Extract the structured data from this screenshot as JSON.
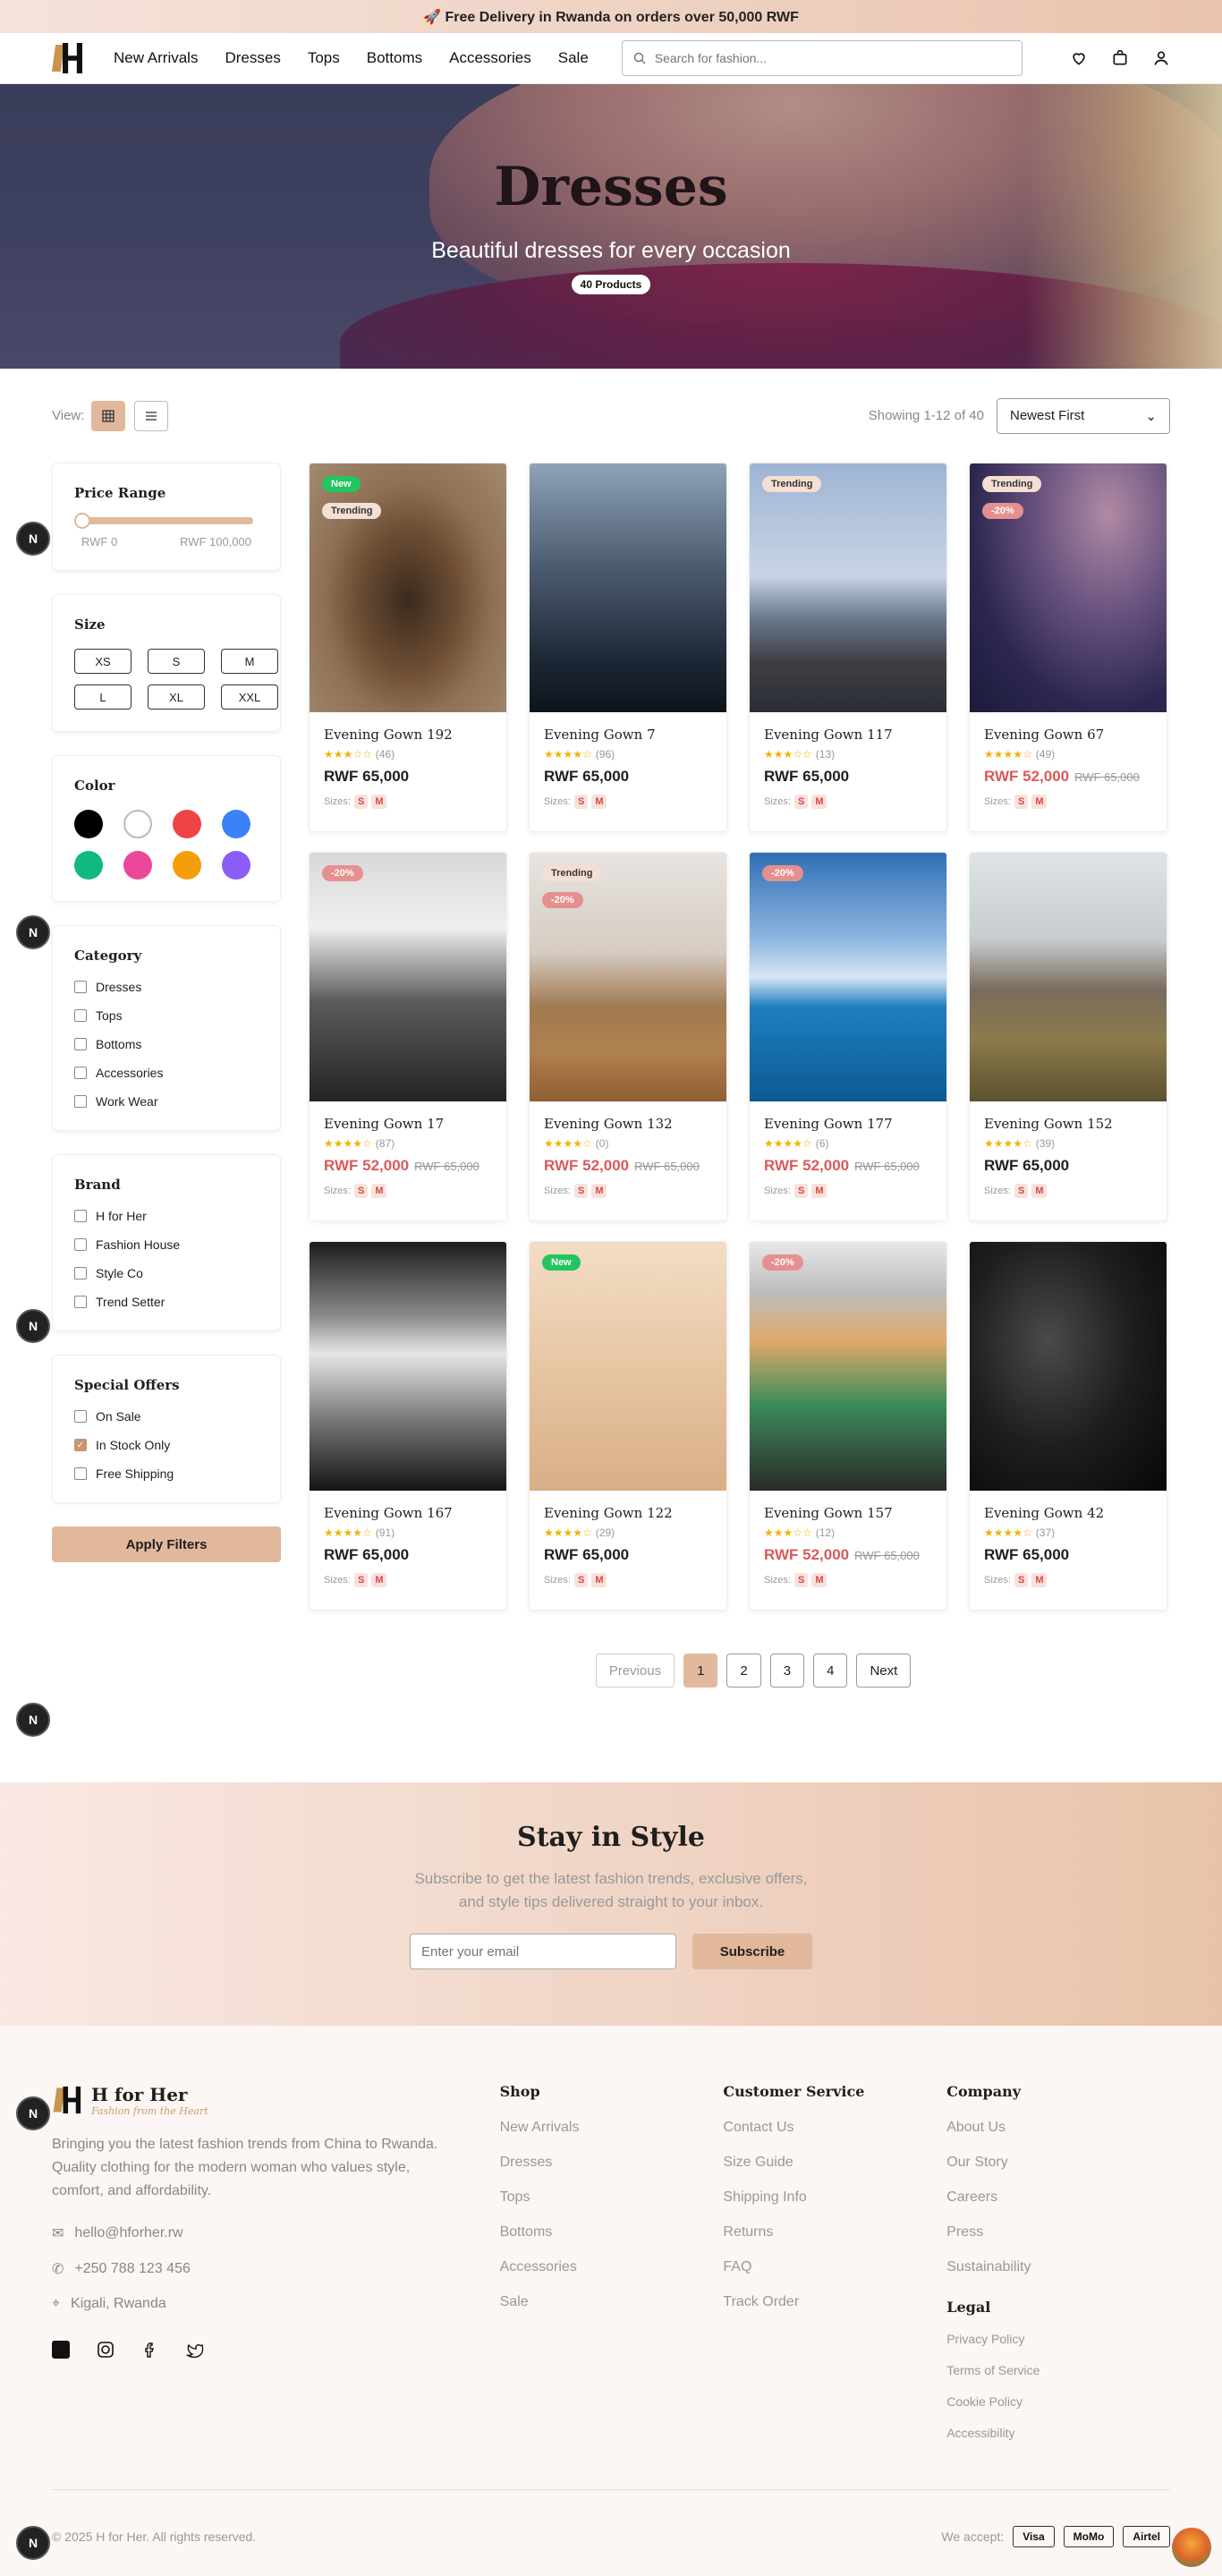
{
  "topbar": {
    "text": "🚀 Free Delivery in Rwanda on orders over 50,000 RWF"
  },
  "nav": {
    "links": [
      "New Arrivals",
      "Dresses",
      "Tops",
      "Bottoms",
      "Accessories",
      "Sale"
    ],
    "search_placeholder": "Search for fashion...",
    "icons": [
      "heart-icon",
      "cart-icon",
      "user-icon"
    ]
  },
  "hero": {
    "title": "Dresses",
    "subtitle": "Beautiful dresses for every occasion",
    "badge": "40 Products"
  },
  "toolbar": {
    "view_label": "View:",
    "showing": "Showing 1-12 of 40",
    "sort": "Newest First"
  },
  "filters": {
    "price": {
      "title": "Price Range",
      "min": "RWF 0",
      "max": "RWF 100,000"
    },
    "size": {
      "title": "Size",
      "options": [
        "XS",
        "S",
        "M",
        "L",
        "XL",
        "XXL"
      ]
    },
    "color": {
      "title": "Color",
      "swatches": [
        "#000000",
        "#ffffff",
        "#ef4444",
        "#3b82f6",
        "#10b981",
        "#ec4899",
        "#f59e0b",
        "#8b5cf6"
      ]
    },
    "category": {
      "title": "Category",
      "options": [
        "Dresses",
        "Tops",
        "Bottoms",
        "Accessories",
        "Work Wear"
      ]
    },
    "brand": {
      "title": "Brand",
      "options": [
        "H for Her",
        "Fashion House",
        "Style Co",
        "Trend Setter"
      ]
    },
    "offers": {
      "title": "Special Offers",
      "options": [
        "On Sale",
        "In Stock Only",
        "Free Shipping"
      ],
      "checked": [
        false,
        true,
        false
      ]
    },
    "apply": "Apply Filters"
  },
  "products": [
    {
      "name": "Evening Gown 192",
      "stars": "★★★☆☆",
      "reviews": "(46)",
      "price": "RWF 65,000",
      "old": "",
      "tags": [
        "New",
        "Trending"
      ],
      "sizes_label": "Sizes:",
      "sizes": [
        "S",
        "M"
      ]
    },
    {
      "name": "Evening Gown 7",
      "stars": "★★★★☆",
      "reviews": "(96)",
      "price": "RWF 65,000",
      "old": "",
      "tags": [],
      "sizes_label": "Sizes:",
      "sizes": [
        "S",
        "M"
      ]
    },
    {
      "name": "Evening Gown 117",
      "stars": "★★★☆☆",
      "reviews": "(13)",
      "price": "RWF 65,000",
      "old": "",
      "tags": [
        "Trending"
      ],
      "sizes_label": "Sizes:",
      "sizes": [
        "S",
        "M"
      ]
    },
    {
      "name": "Evening Gown 67",
      "stars": "★★★★☆",
      "reviews": "(49)",
      "price": "RWF 52,000",
      "old": "RWF 65,000",
      "tags": [
        "Trending",
        "-20%"
      ],
      "sizes_label": "Sizes:",
      "sizes": [
        "S",
        "M"
      ]
    },
    {
      "name": "Evening Gown 17",
      "stars": "★★★★☆",
      "reviews": "(87)",
      "price": "RWF 52,000",
      "old": "RWF 65,000",
      "tags": [
        "-20%"
      ],
      "sizes_label": "Sizes:",
      "sizes": [
        "S",
        "M"
      ]
    },
    {
      "name": "Evening Gown 132",
      "stars": "★★★★☆",
      "reviews": "(0)",
      "price": "RWF 52,000",
      "old": "RWF 65,000",
      "tags": [
        "Trending",
        "-20%"
      ],
      "sizes_label": "Sizes:",
      "sizes": [
        "S",
        "M"
      ]
    },
    {
      "name": "Evening Gown 177",
      "stars": "★★★★☆",
      "reviews": "(6)",
      "price": "RWF 52,000",
      "old": "RWF 65,000",
      "tags": [
        "-20%"
      ],
      "sizes_label": "Sizes:",
      "sizes": [
        "S",
        "M"
      ]
    },
    {
      "name": "Evening Gown 152",
      "stars": "★★★★☆",
      "reviews": "(39)",
      "price": "RWF 65,000",
      "old": "",
      "tags": [],
      "sizes_label": "Sizes:",
      "sizes": [
        "S",
        "M"
      ]
    },
    {
      "name": "Evening Gown 167",
      "stars": "★★★★☆",
      "reviews": "(91)",
      "price": "RWF 65,000",
      "old": "",
      "tags": [],
      "sizes_label": "Sizes:",
      "sizes": [
        "S",
        "M"
      ]
    },
    {
      "name": "Evening Gown 122",
      "stars": "★★★★☆",
      "reviews": "(29)",
      "price": "RWF 65,000",
      "old": "",
      "tags": [
        "New"
      ],
      "sizes_label": "Sizes:",
      "sizes": [
        "S",
        "M"
      ]
    },
    {
      "name": "Evening Gown 157",
      "stars": "★★★☆☆",
      "reviews": "(12)",
      "price": "RWF 52,000",
      "old": "RWF 65,000",
      "tags": [
        "-20%"
      ],
      "sizes_label": "Sizes:",
      "sizes": [
        "S",
        "M"
      ]
    },
    {
      "name": "Evening Gown 42",
      "stars": "★★★★☆",
      "reviews": "(37)",
      "price": "RWF 65,000",
      "old": "",
      "tags": [],
      "sizes_label": "Sizes:",
      "sizes": [
        "S",
        "M"
      ]
    }
  ],
  "pagination": {
    "prev": "Previous",
    "pages": [
      "1",
      "2",
      "3",
      "4"
    ],
    "next": "Next",
    "current": "1"
  },
  "newsletter": {
    "title": "Stay in Style",
    "text": "Subscribe to get the latest fashion trends, exclusive offers, and style tips delivered straight to your inbox.",
    "placeholder": "Enter your email",
    "button": "Subscribe"
  },
  "footer": {
    "brand": "H for Her",
    "tagline": "Fashion from the Heart",
    "desc": "Bringing you the latest fashion trends from China to Rwanda. Quality clothing for the modern woman who values style, comfort, and affordability.",
    "email": "hello@hforher.rw",
    "phone": "+250 788 123 456",
    "location": "Kigali, Rwanda",
    "shop": {
      "title": "Shop",
      "links": [
        "New Arrivals",
        "Dresses",
        "Tops",
        "Bottoms",
        "Accessories",
        "Sale"
      ]
    },
    "service": {
      "title": "Customer Service",
      "links": [
        "Contact Us",
        "Size Guide",
        "Shipping Info",
        "Returns",
        "FAQ",
        "Track Order"
      ]
    },
    "company": {
      "title": "Company",
      "links": [
        "About Us",
        "Our Story",
        "Careers",
        "Press",
        "Sustainability"
      ]
    },
    "legal": {
      "title": "Legal",
      "links": [
        "Privacy Policy",
        "Terms of Service",
        "Cookie Policy",
        "Accessibility"
      ]
    },
    "copyright": "© 2025 H for Her. All rights reserved.",
    "we_accept": "We accept:",
    "payments": [
      "Visa",
      "MoMo",
      "Airtel"
    ]
  },
  "bubble_letter": "N"
}
